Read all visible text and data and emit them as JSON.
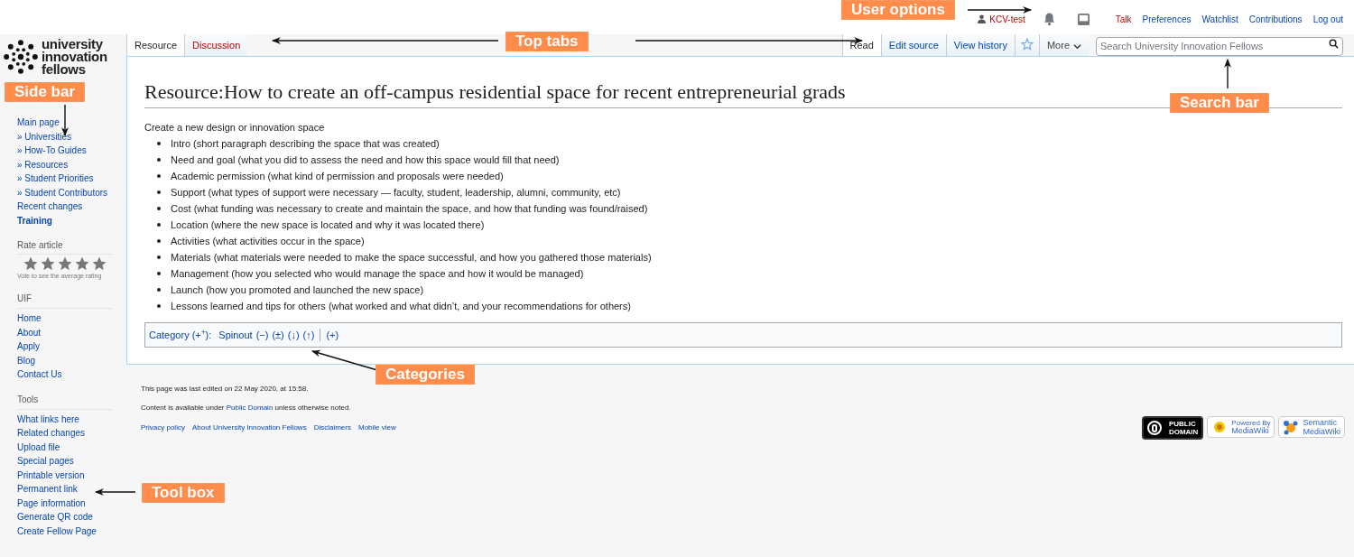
{
  "personal": {
    "user": {
      "label": "KCV-test",
      "exists": false
    },
    "links": [
      {
        "label": "Talk",
        "exists": false
      },
      {
        "label": "Preferences",
        "exists": true
      },
      {
        "label": "Watchlist",
        "exists": true
      },
      {
        "label": "Contributions",
        "exists": true
      },
      {
        "label": "Log out",
        "exists": true
      }
    ]
  },
  "logo": {
    "lines": [
      "university",
      "innovation",
      "fellows"
    ]
  },
  "left_tabs": [
    {
      "label": "Resource",
      "selected": true,
      "exists": true
    },
    {
      "label": "Discussion",
      "selected": false,
      "exists": false
    }
  ],
  "right_tabs": [
    {
      "kind": "text",
      "label": "Read",
      "selected": true
    },
    {
      "kind": "text",
      "label": "Edit source",
      "selected": false
    },
    {
      "kind": "text",
      "label": "View history",
      "selected": false
    },
    {
      "kind": "star",
      "selected": false
    },
    {
      "kind": "menu",
      "label": "More",
      "selected": false
    }
  ],
  "search": {
    "placeholder": "Search University Innovation Fellows"
  },
  "sidebar": {
    "nav": [
      {
        "label": "Main page",
        "bold": false
      },
      {
        "label": "» Universities",
        "bold": false
      },
      {
        "label": "» How-To Guides",
        "bold": false
      },
      {
        "label": "» Resources",
        "bold": false
      },
      {
        "label": "» Student Priorities",
        "bold": false
      },
      {
        "label": "» Student Contributors",
        "bold": false
      },
      {
        "label": "Recent changes",
        "bold": false
      },
      {
        "label": "Training",
        "bold": true
      }
    ],
    "rating": {
      "heading": "Rate article",
      "note": "Vote to see the average rating"
    },
    "sections": [
      {
        "heading": "UIF",
        "items": [
          "Home",
          "About",
          "Apply",
          "Blog",
          "Contact Us"
        ]
      },
      {
        "heading": "Tools",
        "items": [
          "What links here",
          "Related changes",
          "Upload file",
          "Special pages",
          "Printable version",
          "Permanent link",
          "Page information",
          "Generate QR code",
          "Create Fellow Page"
        ]
      }
    ]
  },
  "page": {
    "title": "Resource:How to create an off-campus residential space for recent entrepreneurial grads",
    "intro": "Create a new design or innovation space",
    "bullets": [
      "Intro (short paragraph describing the space that was created)",
      "Need and goal (what you did to assess the need and how this space would fill that need)",
      "Academic permission (what kind of permission and proposals were needed)",
      "Support (what types of support were necessary — faculty, student, leadership, alumni, community, etc)",
      "Cost (what funding was necessary to create and maintain the space, and how that funding was found/raised)",
      "Location (where the new space is located and why it was located there)",
      "Activities (what activities occur in the space)",
      "Materials (what materials were needed to make the space successful, and how you gathered those materials)",
      "Management (how you selected who would manage the space and how it would be managed)",
      "Launch (how you promoted and launched the new space)",
      "Lessons learned and tips for others (what worked and what didn’t, and your recommendations for others)"
    ],
    "categories": {
      "label": "Category (+$^{+}$):",
      "category": "Spinout",
      "actions": [
        "(−)",
        "(±)",
        "(↓)",
        "(↑)"
      ],
      "add": "(+)"
    }
  },
  "footer": {
    "last_edited": "This page was last edited on 22 May 2020, at 15:58.",
    "license": {
      "before": "Content is available under",
      "link": "Public Domain",
      "after": "unless otherwise noted."
    },
    "links": [
      "Privacy policy",
      "About University Innovation Fellows",
      "Disclaimers",
      "Mobile view"
    ],
    "badges": [
      {
        "kind": "pd",
        "lines": [
          "PUBLIC",
          "DOMAIN"
        ]
      },
      {
        "kind": "mw",
        "lines": [
          "Powered By",
          "MediaWiki"
        ]
      },
      {
        "kind": "smw",
        "lines": [
          "Semantic",
          "MediaWiki"
        ]
      }
    ]
  },
  "annotations": [
    "User options",
    "Top tabs",
    "Side bar",
    "Search bar",
    "Categories",
    "Tool box"
  ]
}
